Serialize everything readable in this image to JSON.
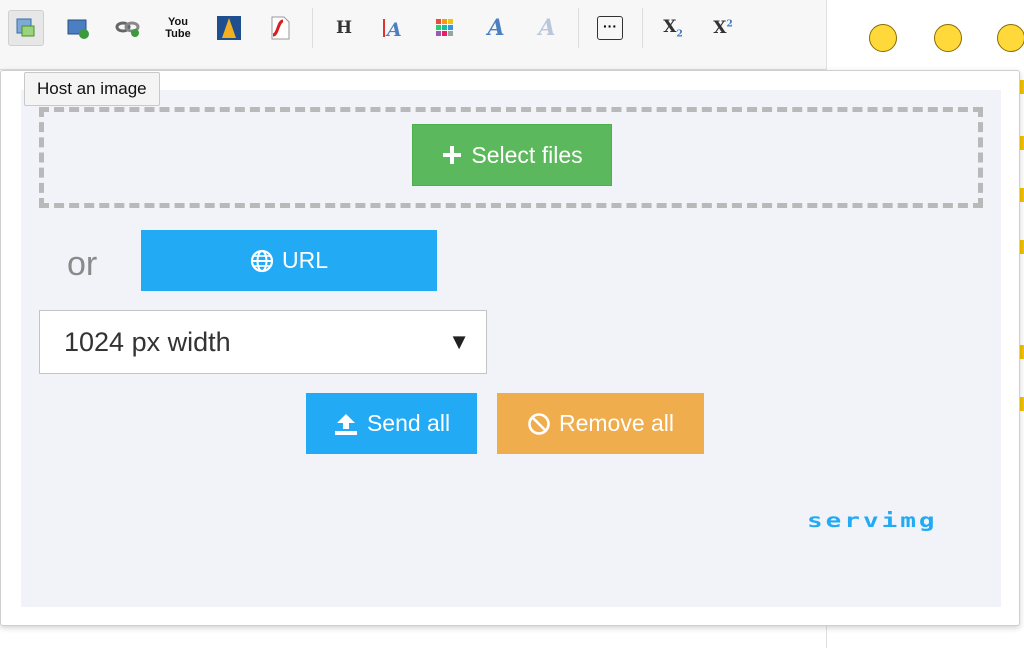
{
  "toolbar": {
    "items": [
      {
        "name": "host-image",
        "icon": "image-upload-icon",
        "active": true
      },
      {
        "name": "insert-image",
        "icon": "image-add-icon"
      },
      {
        "name": "insert-link",
        "icon": "link-icon"
      },
      {
        "name": "insert-youtube",
        "icon": "youtube-icon",
        "label": "You Tube"
      },
      {
        "name": "insert-dailymotion",
        "icon": "dailymotion-icon"
      },
      {
        "name": "insert-flash",
        "icon": "flash-icon"
      },
      {
        "name": "heading",
        "icon": "heading-icon",
        "label": "H"
      },
      {
        "name": "font-size",
        "icon": "font-size-icon"
      },
      {
        "name": "color",
        "icon": "color-palette-icon"
      },
      {
        "name": "font-family",
        "icon": "font-family-icon",
        "label": "A"
      },
      {
        "name": "remove-format",
        "icon": "clear-format-icon",
        "label": "A"
      },
      {
        "name": "more",
        "icon": "more-icon",
        "label": "···"
      },
      {
        "name": "subscript",
        "icon": "subscript-icon",
        "label": "X",
        "sub": "2"
      },
      {
        "name": "superscript",
        "icon": "superscript-icon",
        "label": "X",
        "sup": "2"
      }
    ]
  },
  "tooltip": "Host an image",
  "upload": {
    "select_files": "Select files",
    "or": "or",
    "url": "URL",
    "width_option": "1024 px width",
    "send_all": "Send all",
    "remove_all": "Remove all",
    "brand": "servimg"
  },
  "colors": {
    "green": "#5cb85c",
    "blue": "#22aaf5",
    "orange": "#f0ad4e",
    "panel_bg": "#f2f3f8"
  },
  "emoji": [
    {
      "name": "laughing-smiley-icon"
    },
    {
      "name": "smile-smiley-icon"
    },
    {
      "name": "sad-smiley-icon"
    }
  ]
}
